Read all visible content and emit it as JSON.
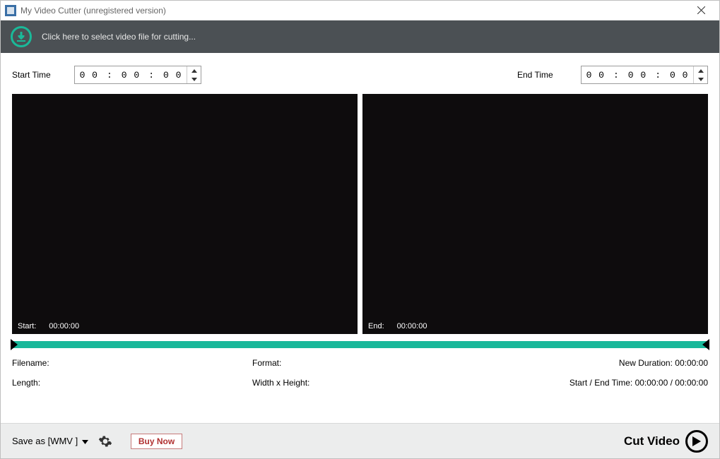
{
  "window": {
    "title": "My Video Cutter (unregistered version)"
  },
  "selectBar": {
    "prompt": "Click here to select video file for cutting..."
  },
  "time": {
    "startLabel": "Start Time",
    "endLabel": "End Time",
    "start": {
      "h": "0 0",
      "m": "0 0",
      "s": "0 0"
    },
    "end": {
      "h": "0 0",
      "m": "0 0",
      "s": "0 0"
    }
  },
  "preview": {
    "left": {
      "label": "Start:",
      "value": "00:00:00"
    },
    "right": {
      "label": "End:",
      "value": "00:00:00"
    }
  },
  "info": {
    "filenameLabel": "Filename:",
    "formatLabel": "Format:",
    "lengthLabel": "Length:",
    "widthHeightLabel": "Width x Height:",
    "newDurationLabel": "New Duration:",
    "newDurationValue": "00:00:00",
    "startEndLabel": "Start / End Time:",
    "startEndValue": "00:00:00 / 00:00:00"
  },
  "bottom": {
    "saveAsPrefix": "Save as [",
    "saveAsFormat": "WMV",
    "saveAsSuffix": "]",
    "buyNow": "Buy Now",
    "cutVideo": "Cut Video"
  }
}
